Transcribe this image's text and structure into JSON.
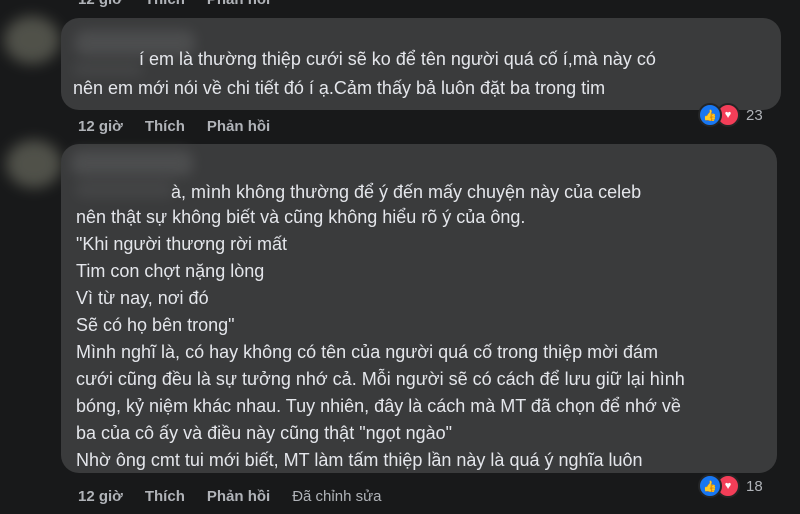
{
  "top_actions": {
    "time": "12 giờ",
    "like": "Thích",
    "reply": "Phản hồi"
  },
  "comment1": {
    "lines": [
      "í em là thường thiệp cưới sẽ ko để tên người quá cố í,mà này có",
      "nên em mới nói về chi tiết đó í ạ.Cảm thấy bả luôn đặt ba trong tim"
    ],
    "reaction_count": "23",
    "actions": {
      "time": "12 giờ",
      "like": "Thích",
      "reply": "Phản hồi"
    }
  },
  "comment2": {
    "lines": [
      "à, mình không thường để ý đến mấy chuyện này của celeb",
      "nên thật sự không biết và cũng không hiểu rõ ý của ông.",
      "\"Khi người thương rời mất",
      "Tim con chợt nặng lòng",
      "Vì từ nay, nơi đó",
      "Sẽ có họ bên trong\"",
      "Mình nghĩ là, có hay không có tên của người quá cố trong thiệp mời đám",
      "cưới cũng đều là sự tưởng nhớ cả. Mỗi người sẽ có cách để lưu giữ lại hình",
      "bóng, kỷ niệm khác nhau. Tuy nhiên, đây là cách mà MT đã chọn để nhớ về",
      "ba của cô ấy và điều này cũng thật \"ngọt ngào\"",
      "Nhờ ông cmt tui mới biết, MT làm tấm thiệp lần này là quá ý nghĩa luôn"
    ],
    "reaction_count": "18",
    "actions": {
      "time": "12 giờ",
      "like": "Thích",
      "reply": "Phản hồi",
      "edited": "Đã chỉnh sửa"
    }
  },
  "icons": {
    "like": "like-icon",
    "love": "love-icon"
  },
  "colors": {
    "background": "#18191a",
    "bubble": "#3a3b3c",
    "like": "#1877f2",
    "love": "#f33e58"
  }
}
